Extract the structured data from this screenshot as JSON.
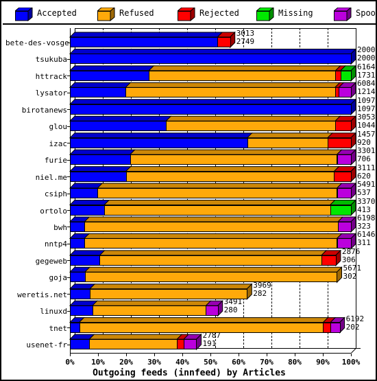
{
  "legend": {
    "items": [
      {
        "label": "Accepted",
        "color": "#0000ff",
        "icon": "cube-icon"
      },
      {
        "label": "Refused",
        "color": "#ffa90a",
        "icon": "cube-icon"
      },
      {
        "label": "Rejected",
        "color": "#ff0000",
        "icon": "cube-icon"
      },
      {
        "label": "Missing",
        "color": "#00e800",
        "icon": "cube-icon"
      },
      {
        "label": "Spooled",
        "color": "#bb00dd",
        "icon": "cube-icon"
      }
    ]
  },
  "chart_data": {
    "type": "bar",
    "orientation": "horizontal",
    "stacked": true,
    "title": "Outgoing feeds (innfeed) by Articles",
    "xlabel": "Outgoing feeds (innfeed) by Articles",
    "ylabel": "",
    "xlim": [
      0,
      100
    ],
    "x_unit": "%",
    "xticks": [
      "0%",
      "10%",
      "20%",
      "30%",
      "40%",
      "50%",
      "60%",
      "70%",
      "80%",
      "90%",
      "100%"
    ],
    "xtick_values": [
      0,
      10,
      20,
      30,
      40,
      50,
      60,
      70,
      80,
      90,
      100
    ],
    "grid": true,
    "legend_position": "top",
    "series": [
      {
        "name": "Accepted",
        "color": "#0000ff"
      },
      {
        "name": "Refused",
        "color": "#ffa90a"
      },
      {
        "name": "Rejected",
        "color": "#ff0000"
      },
      {
        "name": "Missing",
        "color": "#00e800"
      },
      {
        "name": "Spooled",
        "color": "#bb00dd"
      }
    ],
    "categories": [
      "bete-des-vosges",
      "tsukuba",
      "httrack",
      "lysator",
      "birotanews",
      "glou",
      "izac",
      "furie",
      "niel.me",
      "csiph",
      "ortolo",
      "bwh",
      "nntp4",
      "gegeweb",
      "goja",
      "weretis.net",
      "linuxd",
      "tnet",
      "usenet-fr"
    ],
    "rows": [
      {
        "label": "bete-des-vosges",
        "top_value": "3013",
        "bottom_value": "2749",
        "segments": [
          {
            "series": "Accepted",
            "pct": 52.5
          },
          {
            "series": "Rejected",
            "pct": 4.5
          }
        ]
      },
      {
        "label": "tsukuba",
        "top_value": "2000",
        "bottom_value": "2000",
        "segments": [
          {
            "series": "Accepted",
            "pct": 100.0
          }
        ]
      },
      {
        "label": "httrack",
        "top_value": "6164",
        "bottom_value": "1731",
        "segments": [
          {
            "series": "Accepted",
            "pct": 28.1
          },
          {
            "series": "Refused",
            "pct": 66.4
          },
          {
            "series": "Rejected",
            "pct": 1.8
          },
          {
            "series": "Missing",
            "pct": 3.7
          }
        ]
      },
      {
        "label": "lysator",
        "top_value": "6084",
        "bottom_value": "1214",
        "segments": [
          {
            "series": "Accepted",
            "pct": 19.8
          },
          {
            "series": "Refused",
            "pct": 74.5
          },
          {
            "series": "Rejected",
            "pct": 1.4
          },
          {
            "series": "Spooled",
            "pct": 4.3
          }
        ]
      },
      {
        "label": "birotanews",
        "top_value": "1097",
        "bottom_value": "1097",
        "segments": [
          {
            "series": "Accepted",
            "pct": 100.0
          }
        ]
      },
      {
        "label": "glou",
        "top_value": "3053",
        "bottom_value": "1044",
        "segments": [
          {
            "series": "Accepted",
            "pct": 34.2
          },
          {
            "series": "Refused",
            "pct": 60.2
          },
          {
            "series": "Rejected",
            "pct": 5.6
          }
        ]
      },
      {
        "label": "izac",
        "top_value": "1457",
        "bottom_value": "920",
        "segments": [
          {
            "series": "Accepted",
            "pct": 63.1
          },
          {
            "series": "Refused",
            "pct": 28.6
          },
          {
            "series": "Rejected",
            "pct": 8.3
          }
        ]
      },
      {
        "label": "furie",
        "top_value": "3301",
        "bottom_value": "706",
        "segments": [
          {
            "series": "Accepted",
            "pct": 21.4
          },
          {
            "series": "Refused",
            "pct": 73.6
          },
          {
            "series": "Spooled",
            "pct": 5.0
          }
        ]
      },
      {
        "label": "niel.me",
        "top_value": "3111",
        "bottom_value": "620",
        "segments": [
          {
            "series": "Accepted",
            "pct": 19.9
          },
          {
            "series": "Refused",
            "pct": 74.1
          },
          {
            "series": "Rejected",
            "pct": 6.0
          }
        ]
      },
      {
        "label": "csiph",
        "top_value": "5491",
        "bottom_value": "537",
        "segments": [
          {
            "series": "Accepted",
            "pct": 9.8
          },
          {
            "series": "Refused",
            "pct": 85.2
          },
          {
            "series": "Spooled",
            "pct": 5.0
          }
        ]
      },
      {
        "label": "ortolo",
        "top_value": "3370",
        "bottom_value": "413",
        "segments": [
          {
            "series": "Accepted",
            "pct": 12.2
          },
          {
            "series": "Refused",
            "pct": 80.4
          },
          {
            "series": "Missing",
            "pct": 7.4
          }
        ]
      },
      {
        "label": "bwh",
        "top_value": "6198",
        "bottom_value": "323",
        "segments": [
          {
            "series": "Accepted",
            "pct": 5.2
          },
          {
            "series": "Refused",
            "pct": 90.2
          },
          {
            "series": "Spooled",
            "pct": 4.6
          }
        ]
      },
      {
        "label": "nntp4",
        "top_value": "6146",
        "bottom_value": "311",
        "segments": [
          {
            "series": "Accepted",
            "pct": 5.1
          },
          {
            "series": "Refused",
            "pct": 89.9
          },
          {
            "series": "Spooled",
            "pct": 5.0
          }
        ]
      },
      {
        "label": "gegeweb",
        "top_value": "2876",
        "bottom_value": "306",
        "segments": [
          {
            "series": "Accepted",
            "pct": 10.6
          },
          {
            "series": "Refused",
            "pct": 78.9
          },
          {
            "series": "Rejected",
            "pct": 5.1
          }
        ]
      },
      {
        "label": "goja",
        "top_value": "5671",
        "bottom_value": "302",
        "segments": [
          {
            "series": "Accepted",
            "pct": 5.3
          },
          {
            "series": "Refused",
            "pct": 89.7
          }
        ]
      },
      {
        "label": "weretis.net",
        "top_value": "3969",
        "bottom_value": "282",
        "segments": [
          {
            "series": "Accepted",
            "pct": 7.1
          },
          {
            "series": "Refused",
            "pct": 55.9
          }
        ]
      },
      {
        "label": "linuxd",
        "top_value": "3491",
        "bottom_value": "280",
        "segments": [
          {
            "series": "Accepted",
            "pct": 8.0
          },
          {
            "series": "Refused",
            "pct": 40.4
          },
          {
            "series": "Spooled",
            "pct": 4.2
          }
        ]
      },
      {
        "label": "tnet",
        "top_value": "6192",
        "bottom_value": "202",
        "segments": [
          {
            "series": "Accepted",
            "pct": 3.3
          },
          {
            "series": "Refused",
            "pct": 86.8
          },
          {
            "series": "Rejected",
            "pct": 2.6
          },
          {
            "series": "Spooled",
            "pct": 3.3
          }
        ]
      },
      {
        "label": "usenet-fr",
        "top_value": "2787",
        "bottom_value": "191",
        "segments": [
          {
            "series": "Accepted",
            "pct": 6.9
          },
          {
            "series": "Refused",
            "pct": 31.2
          },
          {
            "series": "Rejected",
            "pct": 2.4
          },
          {
            "series": "Spooled",
            "pct": 4.5
          }
        ]
      }
    ]
  }
}
